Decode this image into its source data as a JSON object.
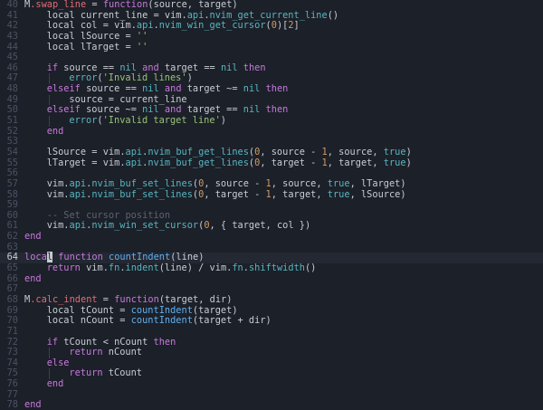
{
  "editor": {
    "theme_colors": {
      "background": "#1c2028",
      "current_line": "#232833",
      "keyword": "#c678dd",
      "function": "#56b6c2",
      "string": "#98c379",
      "number": "#d19a66",
      "comment": "#5c6370",
      "text": "#c8ccd4",
      "line_number": "#4a5263"
    },
    "current_line_number": "64",
    "lines": [
      {
        "n": "40",
        "indent": 0,
        "tokens": [
          [
            "M",
            "t-default"
          ],
          [
            ".swap_line ",
            "t-field"
          ],
          [
            "= ",
            "t-op"
          ],
          [
            "function",
            "t-kw"
          ],
          [
            "(",
            "t-punc"
          ],
          [
            "source",
            "t-default"
          ],
          [
            ", ",
            "t-punc"
          ],
          [
            "target",
            "t-default"
          ],
          [
            ")",
            "t-punc"
          ]
        ]
      },
      {
        "n": "41",
        "indent": 1,
        "tokens": [
          [
            "local ",
            "t-default"
          ],
          [
            "current_line ",
            "t-default"
          ],
          [
            "= ",
            "t-op"
          ],
          [
            "vim",
            "t-default"
          ],
          [
            ".",
            "t-punc"
          ],
          [
            "api",
            "t-fn"
          ],
          [
            ".",
            "t-punc"
          ],
          [
            "nvim_get_current_line",
            "t-fn"
          ],
          [
            "()",
            "t-punc"
          ]
        ]
      },
      {
        "n": "42",
        "indent": 1,
        "tokens": [
          [
            "local ",
            "t-default"
          ],
          [
            "col ",
            "t-default"
          ],
          [
            "= ",
            "t-op"
          ],
          [
            "vim",
            "t-default"
          ],
          [
            ".",
            "t-punc"
          ],
          [
            "api",
            "t-fn"
          ],
          [
            ".",
            "t-punc"
          ],
          [
            "nvim_win_get_cursor",
            "t-fn"
          ],
          [
            "(",
            "t-punc"
          ],
          [
            "0",
            "t-num"
          ],
          [
            ")",
            "t-punc"
          ],
          [
            "[",
            "t-punc"
          ],
          [
            "2",
            "t-num"
          ],
          [
            "]",
            "t-punc"
          ]
        ]
      },
      {
        "n": "43",
        "indent": 1,
        "tokens": [
          [
            "local ",
            "t-default"
          ],
          [
            "lSource ",
            "t-default"
          ],
          [
            "= ",
            "t-op"
          ],
          [
            "''",
            "t-str"
          ]
        ]
      },
      {
        "n": "44",
        "indent": 1,
        "tokens": [
          [
            "local ",
            "t-default"
          ],
          [
            "lTarget ",
            "t-default"
          ],
          [
            "= ",
            "t-op"
          ],
          [
            "''",
            "t-str"
          ]
        ]
      },
      {
        "n": "45",
        "indent": 0,
        "tokens": []
      },
      {
        "n": "46",
        "indent": 1,
        "tokens": [
          [
            "if ",
            "t-kw"
          ],
          [
            "source ",
            "t-default"
          ],
          [
            "== ",
            "t-op"
          ],
          [
            "nil ",
            "t-fn"
          ],
          [
            "and ",
            "t-kw"
          ],
          [
            "target ",
            "t-default"
          ],
          [
            "== ",
            "t-op"
          ],
          [
            "nil ",
            "t-fn"
          ],
          [
            "then",
            "t-kw"
          ]
        ]
      },
      {
        "n": "47",
        "indent": 2,
        "tokens": [
          [
            "error",
            "t-fn"
          ],
          [
            "(",
            "t-punc"
          ],
          [
            "'Invalid lines'",
            "t-str"
          ],
          [
            ")",
            "t-punc"
          ]
        ]
      },
      {
        "n": "48",
        "indent": 1,
        "tokens": [
          [
            "elseif ",
            "t-kw"
          ],
          [
            "source ",
            "t-default"
          ],
          [
            "== ",
            "t-op"
          ],
          [
            "nil ",
            "t-fn"
          ],
          [
            "and ",
            "t-kw"
          ],
          [
            "target ",
            "t-default"
          ],
          [
            "~= ",
            "t-op"
          ],
          [
            "nil ",
            "t-fn"
          ],
          [
            "then",
            "t-kw"
          ]
        ]
      },
      {
        "n": "49",
        "indent": 2,
        "tokens": [
          [
            "source ",
            "t-default"
          ],
          [
            "= ",
            "t-op"
          ],
          [
            "current_line",
            "t-default"
          ]
        ]
      },
      {
        "n": "50",
        "indent": 1,
        "tokens": [
          [
            "elseif ",
            "t-kw"
          ],
          [
            "source ",
            "t-default"
          ],
          [
            "~= ",
            "t-op"
          ],
          [
            "nil ",
            "t-fn"
          ],
          [
            "and ",
            "t-kw"
          ],
          [
            "target ",
            "t-default"
          ],
          [
            "== ",
            "t-op"
          ],
          [
            "nil ",
            "t-fn"
          ],
          [
            "then",
            "t-kw"
          ]
        ]
      },
      {
        "n": "51",
        "indent": 2,
        "tokens": [
          [
            "error",
            "t-fn"
          ],
          [
            "(",
            "t-punc"
          ],
          [
            "'Invalid target line'",
            "t-str"
          ],
          [
            ")",
            "t-punc"
          ]
        ]
      },
      {
        "n": "52",
        "indent": 1,
        "tokens": [
          [
            "end",
            "t-kw"
          ]
        ]
      },
      {
        "n": "53",
        "indent": 0,
        "tokens": []
      },
      {
        "n": "54",
        "indent": 1,
        "tokens": [
          [
            "lSource ",
            "t-default"
          ],
          [
            "= ",
            "t-op"
          ],
          [
            "vim",
            "t-default"
          ],
          [
            ".",
            "t-punc"
          ],
          [
            "api",
            "t-fn"
          ],
          [
            ".",
            "t-punc"
          ],
          [
            "nvim_buf_get_lines",
            "t-fn"
          ],
          [
            "(",
            "t-punc"
          ],
          [
            "0",
            "t-num"
          ],
          [
            ", ",
            "t-punc"
          ],
          [
            "source ",
            "t-default"
          ],
          [
            "- ",
            "t-op"
          ],
          [
            "1",
            "t-num"
          ],
          [
            ", ",
            "t-punc"
          ],
          [
            "source",
            "t-default"
          ],
          [
            ", ",
            "t-punc"
          ],
          [
            "true",
            "t-bool"
          ],
          [
            ")",
            "t-punc"
          ]
        ]
      },
      {
        "n": "55",
        "indent": 1,
        "tokens": [
          [
            "lTarget ",
            "t-default"
          ],
          [
            "= ",
            "t-op"
          ],
          [
            "vim",
            "t-default"
          ],
          [
            ".",
            "t-punc"
          ],
          [
            "api",
            "t-fn"
          ],
          [
            ".",
            "t-punc"
          ],
          [
            "nvim_buf_get_lines",
            "t-fn"
          ],
          [
            "(",
            "t-punc"
          ],
          [
            "0",
            "t-num"
          ],
          [
            ", ",
            "t-punc"
          ],
          [
            "target ",
            "t-default"
          ],
          [
            "- ",
            "t-op"
          ],
          [
            "1",
            "t-num"
          ],
          [
            ", ",
            "t-punc"
          ],
          [
            "target",
            "t-default"
          ],
          [
            ", ",
            "t-punc"
          ],
          [
            "true",
            "t-bool"
          ],
          [
            ")",
            "t-punc"
          ]
        ]
      },
      {
        "n": "56",
        "indent": 0,
        "tokens": []
      },
      {
        "n": "57",
        "indent": 1,
        "tokens": [
          [
            "vim",
            "t-default"
          ],
          [
            ".",
            "t-punc"
          ],
          [
            "api",
            "t-fn"
          ],
          [
            ".",
            "t-punc"
          ],
          [
            "nvim_buf_set_lines",
            "t-fn"
          ],
          [
            "(",
            "t-punc"
          ],
          [
            "0",
            "t-num"
          ],
          [
            ", ",
            "t-punc"
          ],
          [
            "source ",
            "t-default"
          ],
          [
            "- ",
            "t-op"
          ],
          [
            "1",
            "t-num"
          ],
          [
            ", ",
            "t-punc"
          ],
          [
            "source",
            "t-default"
          ],
          [
            ", ",
            "t-punc"
          ],
          [
            "true",
            "t-bool"
          ],
          [
            ", ",
            "t-punc"
          ],
          [
            "lTarget",
            "t-default"
          ],
          [
            ")",
            "t-punc"
          ]
        ]
      },
      {
        "n": "58",
        "indent": 1,
        "tokens": [
          [
            "vim",
            "t-default"
          ],
          [
            ".",
            "t-punc"
          ],
          [
            "api",
            "t-fn"
          ],
          [
            ".",
            "t-punc"
          ],
          [
            "nvim_buf_set_lines",
            "t-fn"
          ],
          [
            "(",
            "t-punc"
          ],
          [
            "0",
            "t-num"
          ],
          [
            ", ",
            "t-punc"
          ],
          [
            "target ",
            "t-default"
          ],
          [
            "- ",
            "t-op"
          ],
          [
            "1",
            "t-num"
          ],
          [
            ", ",
            "t-punc"
          ],
          [
            "target",
            "t-default"
          ],
          [
            ", ",
            "t-punc"
          ],
          [
            "true",
            "t-bool"
          ],
          [
            ", ",
            "t-punc"
          ],
          [
            "lSource",
            "t-default"
          ],
          [
            ")",
            "t-punc"
          ]
        ]
      },
      {
        "n": "59",
        "indent": 0,
        "tokens": []
      },
      {
        "n": "60",
        "indent": 1,
        "tokens": [
          [
            "-- Set cursor position",
            "t-com"
          ]
        ]
      },
      {
        "n": "61",
        "indent": 1,
        "tokens": [
          [
            "vim",
            "t-default"
          ],
          [
            ".",
            "t-punc"
          ],
          [
            "api",
            "t-fn"
          ],
          [
            ".",
            "t-punc"
          ],
          [
            "nvim_win_set_cursor",
            "t-fn"
          ],
          [
            "(",
            "t-punc"
          ],
          [
            "0",
            "t-num"
          ],
          [
            ", ",
            "t-punc"
          ],
          [
            "{ ",
            "t-punc"
          ],
          [
            "target",
            "t-default"
          ],
          [
            ", ",
            "t-punc"
          ],
          [
            "col ",
            "t-default"
          ],
          [
            "})",
            "t-punc"
          ]
        ]
      },
      {
        "n": "62",
        "indent": 0,
        "tokens": [
          [
            "end",
            "t-kw"
          ]
        ]
      },
      {
        "n": "63",
        "indent": 0,
        "tokens": []
      },
      {
        "n": "64",
        "indent": 0,
        "current": true,
        "tokens": [
          [
            "loca",
            "t-kw"
          ],
          [
            "l",
            "t-cursor"
          ],
          [
            " ",
            "t-default"
          ],
          [
            "function ",
            "t-kw"
          ],
          [
            "countIndent",
            "t-id"
          ],
          [
            "(",
            "t-punc"
          ],
          [
            "line",
            "t-default"
          ],
          [
            ")",
            "t-punc"
          ]
        ]
      },
      {
        "n": "65",
        "indent": 1,
        "tokens": [
          [
            "return ",
            "t-kw"
          ],
          [
            "vim",
            "t-default"
          ],
          [
            ".",
            "t-punc"
          ],
          [
            "fn",
            "t-fn"
          ],
          [
            ".",
            "t-punc"
          ],
          [
            "indent",
            "t-fn"
          ],
          [
            "(",
            "t-punc"
          ],
          [
            "line",
            "t-default"
          ],
          [
            ") ",
            "t-punc"
          ],
          [
            "/ ",
            "t-op"
          ],
          [
            "vim",
            "t-default"
          ],
          [
            ".",
            "t-punc"
          ],
          [
            "fn",
            "t-fn"
          ],
          [
            ".",
            "t-punc"
          ],
          [
            "shiftwidth",
            "t-fn"
          ],
          [
            "()",
            "t-punc"
          ]
        ]
      },
      {
        "n": "66",
        "indent": 0,
        "tokens": [
          [
            "end",
            "t-kw"
          ]
        ]
      },
      {
        "n": "67",
        "indent": 0,
        "tokens": []
      },
      {
        "n": "68",
        "indent": 0,
        "tokens": [
          [
            "M",
            "t-default"
          ],
          [
            ".calc_indent ",
            "t-field"
          ],
          [
            "= ",
            "t-op"
          ],
          [
            "function",
            "t-kw"
          ],
          [
            "(",
            "t-punc"
          ],
          [
            "target",
            "t-default"
          ],
          [
            ", ",
            "t-punc"
          ],
          [
            "dir",
            "t-default"
          ],
          [
            ")",
            "t-punc"
          ]
        ]
      },
      {
        "n": "69",
        "indent": 1,
        "tokens": [
          [
            "local ",
            "t-default"
          ],
          [
            "tCount ",
            "t-default"
          ],
          [
            "= ",
            "t-op"
          ],
          [
            "countIndent",
            "t-id"
          ],
          [
            "(",
            "t-punc"
          ],
          [
            "target",
            "t-default"
          ],
          [
            ")",
            "t-punc"
          ]
        ]
      },
      {
        "n": "70",
        "indent": 1,
        "tokens": [
          [
            "local ",
            "t-default"
          ],
          [
            "nCount ",
            "t-default"
          ],
          [
            "= ",
            "t-op"
          ],
          [
            "countIndent",
            "t-id"
          ],
          [
            "(",
            "t-punc"
          ],
          [
            "target ",
            "t-default"
          ],
          [
            "+ ",
            "t-op"
          ],
          [
            "dir",
            "t-default"
          ],
          [
            ")",
            "t-punc"
          ]
        ]
      },
      {
        "n": "71",
        "indent": 0,
        "tokens": []
      },
      {
        "n": "72",
        "indent": 1,
        "tokens": [
          [
            "if ",
            "t-kw"
          ],
          [
            "tCount ",
            "t-default"
          ],
          [
            "< ",
            "t-op"
          ],
          [
            "nCount ",
            "t-default"
          ],
          [
            "then",
            "t-kw"
          ]
        ]
      },
      {
        "n": "73",
        "indent": 2,
        "tokens": [
          [
            "return ",
            "t-kw"
          ],
          [
            "nCount",
            "t-default"
          ]
        ]
      },
      {
        "n": "74",
        "indent": 1,
        "tokens": [
          [
            "else",
            "t-kw"
          ]
        ]
      },
      {
        "n": "75",
        "indent": 2,
        "tokens": [
          [
            "return ",
            "t-kw"
          ],
          [
            "tCount",
            "t-default"
          ]
        ]
      },
      {
        "n": "76",
        "indent": 1,
        "tokens": [
          [
            "end",
            "t-kw"
          ]
        ]
      },
      {
        "n": "77",
        "indent": 0,
        "tokens": []
      },
      {
        "n": "78",
        "indent": 0,
        "tokens": [
          [
            "end",
            "t-kw"
          ]
        ]
      }
    ]
  }
}
